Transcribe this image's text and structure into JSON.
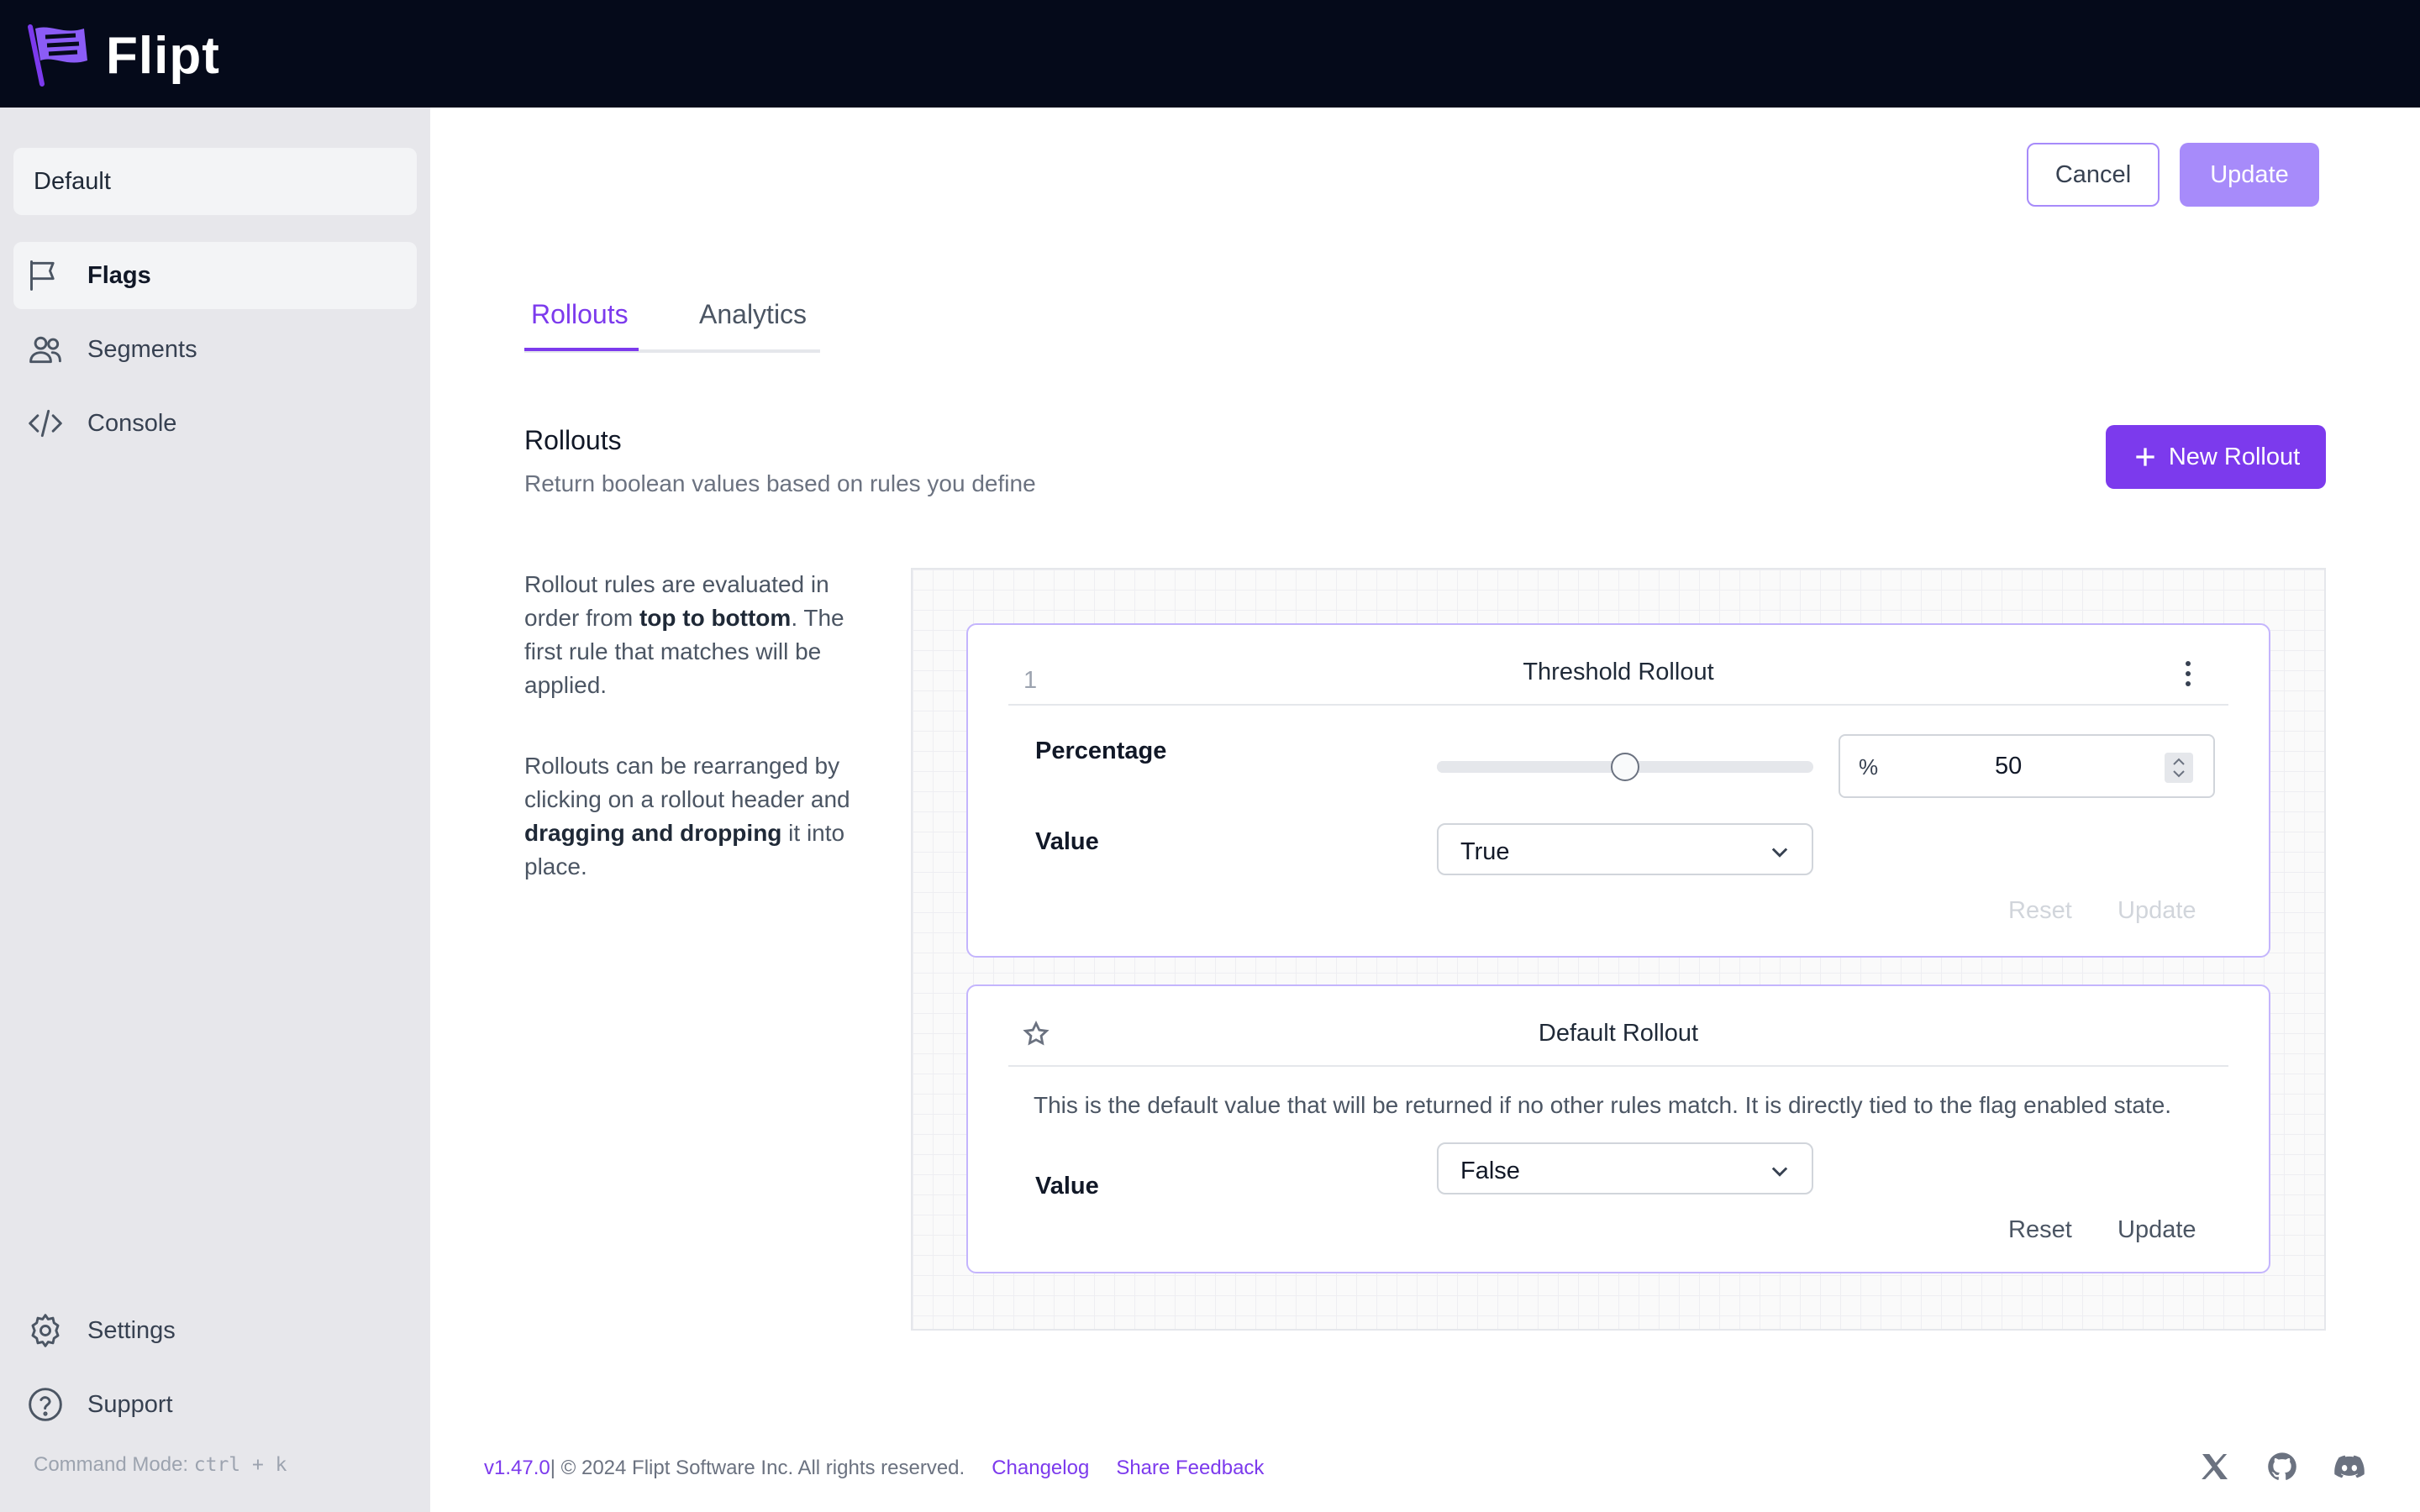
{
  "brand": {
    "name": "Flipt",
    "accent": "#7c3aed",
    "accent_light": "#a78bfa"
  },
  "sidebar": {
    "namespace": "Default",
    "items": [
      {
        "label": "Flags",
        "icon": "flag-icon",
        "active": true
      },
      {
        "label": "Segments",
        "icon": "users-icon",
        "active": false
      },
      {
        "label": "Console",
        "icon": "code-icon",
        "active": false
      }
    ],
    "bottom_items": [
      {
        "label": "Settings",
        "icon": "gear-icon"
      },
      {
        "label": "Support",
        "icon": "help-circle-icon"
      }
    ],
    "command_mode_label": "Command Mode:",
    "command_mode_keys": "ctrl + k"
  },
  "header": {
    "cancel_label": "Cancel",
    "update_label": "Update"
  },
  "tabs": [
    {
      "label": "Rollouts",
      "active": true
    },
    {
      "label": "Analytics",
      "active": false
    }
  ],
  "section": {
    "title": "Rollouts",
    "description": "Return boolean values based on rules you define",
    "new_button_label": "New Rollout"
  },
  "help": {
    "p1_a": "Rollout rules are evaluated in order from ",
    "p1_b": "top to bottom",
    "p1_c": ". The first rule that matches will be applied.",
    "p2_a": "Rollouts can be rearranged by clicking on a rollout header and ",
    "p2_b": "dragging and dropping",
    "p2_c": " it into place."
  },
  "threshold_rollout": {
    "rank": "1",
    "title": "Threshold Rollout",
    "percentage_label": "Percentage",
    "percentage_symbol": "%",
    "percentage_value": "50",
    "percentage_fraction": 0.5,
    "value_label": "Value",
    "value_selected": "True",
    "reset_label": "Reset",
    "update_label": "Update"
  },
  "default_rollout": {
    "title": "Default Rollout",
    "description": "This is the default value that will be returned if no other rules match. It is directly tied to the flag enabled state.",
    "value_label": "Value",
    "value_selected": "False",
    "reset_label": "Reset",
    "update_label": "Update"
  },
  "footer": {
    "version": "v1.47.0",
    "copyright": " | © 2024 Flipt Software Inc. All rights reserved.",
    "changelog": "Changelog",
    "feedback": "Share Feedback",
    "social_icons": [
      "x-icon",
      "github-icon",
      "discord-icon"
    ]
  }
}
